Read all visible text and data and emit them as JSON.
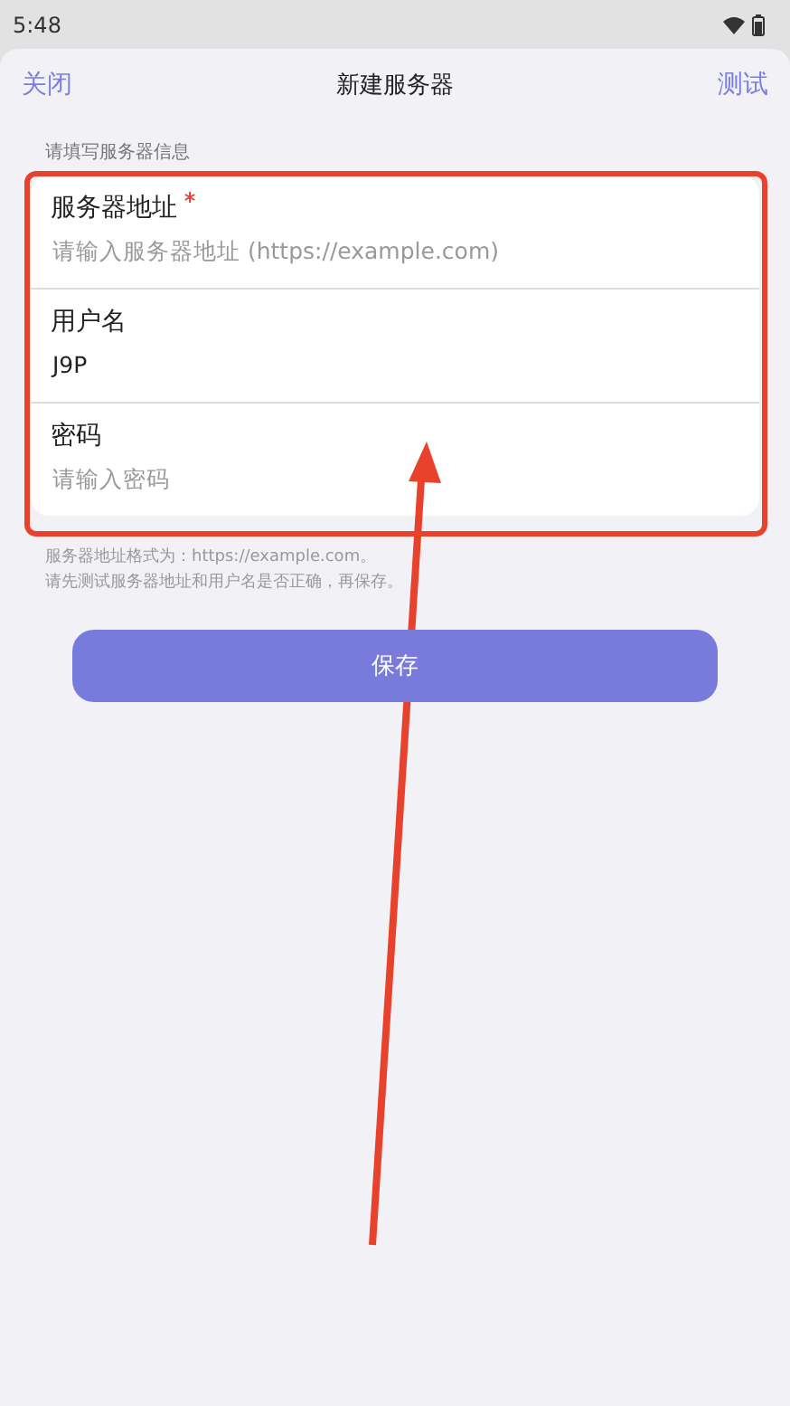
{
  "status_bar": {
    "time": "5:48"
  },
  "header": {
    "close": "关闭",
    "title": "新建服务器",
    "test": "测试"
  },
  "section_label": "请填写服务器信息",
  "fields": [
    {
      "label": "服务器地址",
      "required": true,
      "placeholder": "请输入服务器地址 (https://example.com)"
    },
    {
      "label": "用户名",
      "required": false,
      "value": "J9P"
    },
    {
      "label": "密码",
      "required": false,
      "placeholder": "请输入密码"
    }
  ],
  "hints": [
    "服务器地址格式为：https://example.com。",
    "请先测试服务器地址和用户名是否正确，再保存。"
  ],
  "save_button": "保存"
}
